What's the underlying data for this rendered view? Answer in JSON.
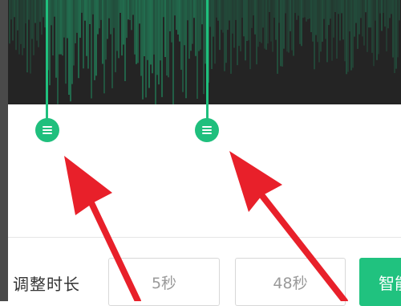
{
  "editor": {
    "waveform_color": "#1fbf7d",
    "background_color": "#242424"
  },
  "controls": {
    "adjust_duration_label": "调整时长",
    "start_time": "5秒",
    "end_time": "48秒",
    "smart_button_label": "智能"
  },
  "annotations": {
    "arrow_color": "#e8202a"
  },
  "icons": {
    "trim_handle": "hamburger-grip-icon"
  }
}
